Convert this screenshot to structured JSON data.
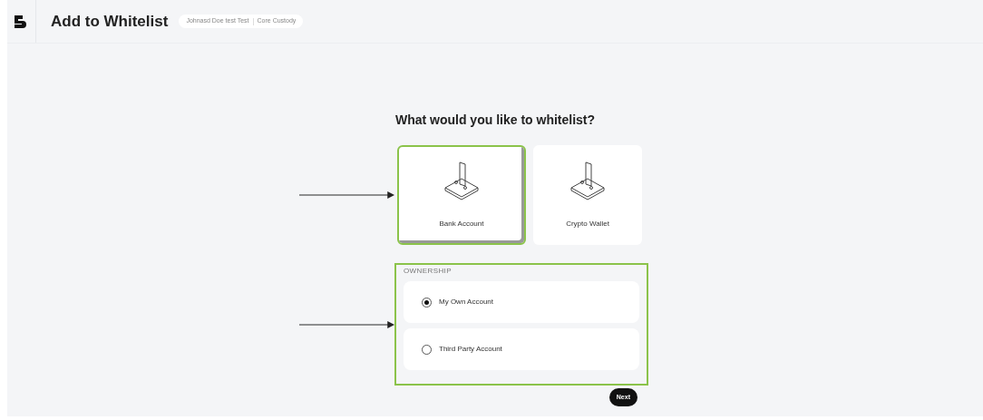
{
  "header": {
    "title": "Add to Whitelist",
    "badge": [
      "Johnasd Doe test Test",
      "Core Custody"
    ]
  },
  "question": "What would you like to whitelist?",
  "types": [
    {
      "label": "Bank Account",
      "selected": true
    },
    {
      "label": "Crypto Wallet",
      "selected": false
    }
  ],
  "ownership": {
    "label": "OWNERSHIP",
    "options": [
      {
        "label": "My Own Account",
        "selected": true
      },
      {
        "label": "Third Party Account",
        "selected": false
      }
    ]
  },
  "next_button": "Next"
}
